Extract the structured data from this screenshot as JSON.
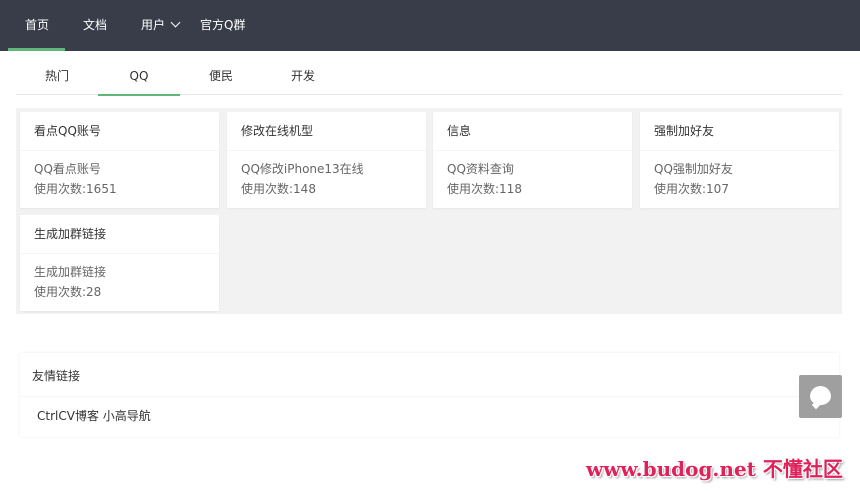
{
  "topnav": {
    "items": [
      {
        "label": "首页",
        "active": true
      },
      {
        "label": "文档"
      },
      {
        "label": "用户"
      },
      {
        "label": "官方Q群"
      }
    ]
  },
  "tabs": [
    {
      "label": "热门"
    },
    {
      "label": "QQ",
      "active": true
    },
    {
      "label": "便民"
    },
    {
      "label": "开发"
    }
  ],
  "cards": [
    {
      "title": "看点QQ账号",
      "desc": "QQ看点账号",
      "usage": "使用次数:1651"
    },
    {
      "title": "修改在线机型",
      "desc": "QQ修改iPhone13在线",
      "usage": "使用次数:148"
    },
    {
      "title": "信息",
      "desc": "QQ资料查询",
      "usage": "使用次数:118"
    },
    {
      "title": "强制加好友",
      "desc": "QQ强制加好友",
      "usage": "使用次数:107"
    },
    {
      "title": "生成加群链接",
      "desc": "生成加群链接",
      "usage": "使用次数:28"
    }
  ],
  "friend_links": {
    "title": "友情链接",
    "items": [
      "CtrlCV博客",
      "小高导航"
    ]
  },
  "chat_button": {
    "icon": "qq-penguin-icon"
  },
  "watermark": {
    "text": "www.budog.net 不懂社区"
  },
  "colors": {
    "nav_bg": "#393d49",
    "accent": "#5fb878",
    "content_bg": "#f2f2f2",
    "watermark": "#e0225a"
  }
}
